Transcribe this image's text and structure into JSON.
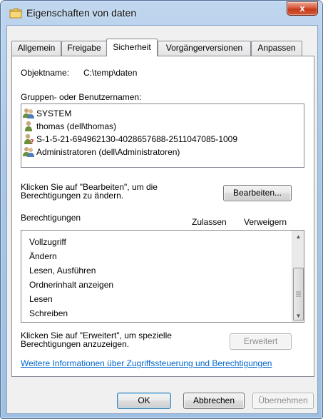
{
  "window": {
    "title": "Eigenschaften von daten",
    "close_label": "x"
  },
  "tabs": [
    {
      "label": "Allgemein",
      "active": false
    },
    {
      "label": "Freigabe",
      "active": false
    },
    {
      "label": "Sicherheit",
      "active": true
    },
    {
      "label": "Vorgängerversionen",
      "active": false
    },
    {
      "label": "Anpassen",
      "active": false
    }
  ],
  "security": {
    "object_name_label": "Objektname:",
    "object_name_value": "C:\\temp\\daten",
    "groups_label": "Gruppen- oder Benutzernamen:",
    "users": [
      {
        "name": "SYSTEM",
        "icon": "group-icon"
      },
      {
        "name": "thomas (dell\\thomas)",
        "icon": "user-icon"
      },
      {
        "name": "S-1-5-21-694962130-4028657688-2511047085-1009",
        "icon": "unknown-user-icon"
      },
      {
        "name": "Administratoren (dell\\Administratoren)",
        "icon": "group-icon"
      }
    ],
    "edit_hint_line1": "Klicken Sie auf \"Bearbeiten\", um die",
    "edit_hint_line2": "Berechtigungen zu ändern.",
    "edit_button": "Bearbeiten...",
    "permissions_label": "Berechtigungen",
    "allow_label": "Zulassen",
    "deny_label": "Verweigern",
    "permissions": [
      "Vollzugriff",
      "Ändern",
      "Lesen, Ausführen",
      "Ordnerinhalt anzeigen",
      "Lesen",
      "Schreiben"
    ],
    "advanced_hint_line1": "Klicken Sie auf \"Erweitert\", um spezielle",
    "advanced_hint_line2": "Berechtigungen anzuzeigen.",
    "advanced_button": "Erweitert",
    "info_link": "Weitere Informationen über Zugriffssteuerung und Berechtigungen"
  },
  "footer": {
    "ok": "OK",
    "cancel": "Abbrechen",
    "apply": "Übernehmen"
  },
  "colors": {
    "link": "#0066cc",
    "title_bar": "#a9c6e6",
    "close_button": "#c4391d"
  }
}
